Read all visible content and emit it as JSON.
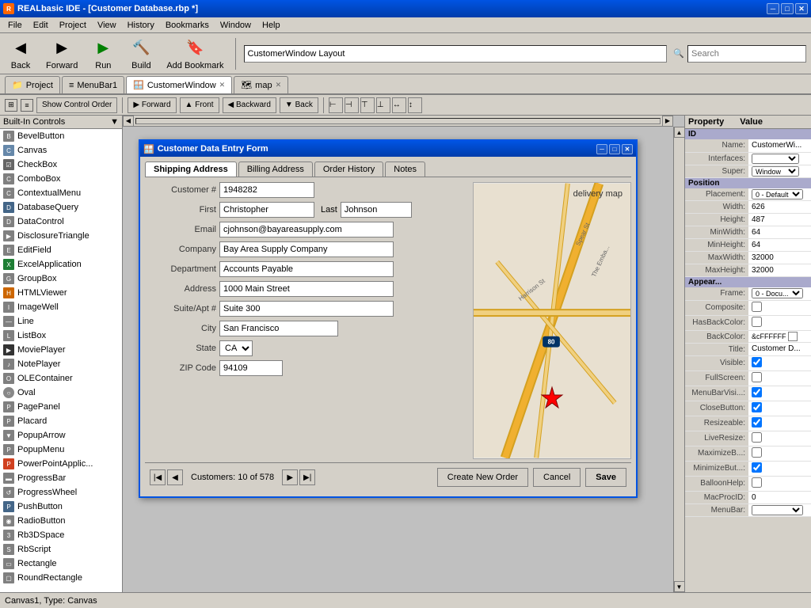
{
  "titlebar": {
    "title": "REALbasic IDE - [Customer Database.rbp *]",
    "icon": "R",
    "min_btn": "─",
    "max_btn": "□",
    "close_btn": "✕"
  },
  "menubar": {
    "items": [
      "File",
      "Edit",
      "Project",
      "View",
      "History",
      "Bookmarks",
      "Window",
      "Help"
    ]
  },
  "toolbar": {
    "back_label": "Back",
    "forward_label": "Forward",
    "run_label": "Run",
    "build_label": "Build",
    "bookmark_label": "Add Bookmark",
    "location_value": "CustomerWindow Layout",
    "search_placeholder": "Search",
    "search_icon": "🔍"
  },
  "tabs": [
    {
      "label": "Project",
      "icon": "📁",
      "active": false,
      "closable": false
    },
    {
      "label": "MenuBar1",
      "icon": "≡",
      "active": false,
      "closable": false
    },
    {
      "label": "CustomerWindow",
      "icon": "🪟",
      "active": true,
      "closable": true
    },
    {
      "label": "map",
      "icon": "🗺",
      "active": false,
      "closable": true
    }
  ],
  "secondary_toolbar": {
    "show_control_order": "Show Control Order",
    "forward_btn": "▶ Forward",
    "front_btn": "▲ Front",
    "backward_btn": "◀ Backward",
    "back_btn": "▼ Back"
  },
  "sidebar": {
    "title": "Built-In Controls",
    "items": [
      "BevelButton",
      "Canvas",
      "CheckBox",
      "ComboBox",
      "ContextualMenu",
      "DatabaseQuery",
      "DataControl",
      "DisclosureTriangle",
      "EditField",
      "ExcelApplication",
      "GroupBox",
      "HTMLViewer",
      "ImageWell",
      "Line",
      "ListBox",
      "MoviePlayer",
      "NotePlayer",
      "OLEContainer",
      "Oval",
      "PagePanel",
      "Placard",
      "PopupArrow",
      "PopupMenu",
      "PowerPointApplic...",
      "ProgressBar",
      "ProgressWheel",
      "PushButton",
      "RadioButton",
      "Rb3DSpace",
      "RbScript",
      "Rectangle",
      "RoundRectangle"
    ]
  },
  "properties": {
    "header": {
      "property": "Property",
      "value": "Value"
    },
    "id_section": "ID",
    "rows": [
      {
        "label": "Name:",
        "value": "CustomerWi..."
      },
      {
        "label": "Interfaces:",
        "value": ""
      },
      {
        "label": "Super:",
        "value": "Window"
      }
    ],
    "position_section": "Position",
    "position_rows": [
      {
        "label": "Placement:",
        "value": "0 - Default"
      },
      {
        "label": "Width:",
        "value": "626"
      },
      {
        "label": "Height:",
        "value": "487"
      },
      {
        "label": "MinWidth:",
        "value": "64"
      },
      {
        "label": "MinHeight:",
        "value": "64"
      },
      {
        "label": "MaxWidth:",
        "value": "32000"
      },
      {
        "label": "MaxHeight:",
        "value": "32000"
      }
    ],
    "appearance_section": "Appear...",
    "appearance_rows": [
      {
        "label": "Frame:",
        "value": "0 - Docu..."
      },
      {
        "label": "Composite:",
        "value": ""
      },
      {
        "label": "HasBackColor:",
        "value": ""
      },
      {
        "label": "BackColor:",
        "value": "&cFFFFFF"
      },
      {
        "label": "Title:",
        "value": "Customer D..."
      },
      {
        "label": "Visible:",
        "value": "checked"
      },
      {
        "label": "FullScreen:",
        "value": ""
      },
      {
        "label": "MenuBarVisi...:",
        "value": "checked"
      },
      {
        "label": "CloseButton:",
        "value": "checked"
      },
      {
        "label": "Resizeable:",
        "value": "checked"
      },
      {
        "label": "LiveResize:",
        "value": ""
      },
      {
        "label": "MaximizeB...:",
        "value": ""
      },
      {
        "label": "MinimizeBut...:",
        "value": "checked"
      },
      {
        "label": "BalloonHelp:",
        "value": ""
      },
      {
        "label": "MacProcID:",
        "value": "0"
      },
      {
        "label": "MenuBar:",
        "value": ""
      }
    ]
  },
  "modal": {
    "title": "Customer Data Entry Form",
    "tabs": [
      "Shipping Address",
      "Billing Address",
      "Order History",
      "Notes"
    ],
    "active_tab": "Shipping Address",
    "fields": {
      "customer_num_label": "Customer #",
      "customer_num_value": "1948282",
      "first_label": "First",
      "first_value": "Christopher",
      "last_label": "Last",
      "last_value": "Johnson",
      "email_label": "Email",
      "email_value": "cjohnson@bayareasupply.com",
      "company_label": "Company",
      "company_value": "Bay Area Supply Company",
      "department_label": "Department",
      "department_value": "Accounts Payable",
      "address_label": "Address",
      "address_value": "1000 Main Street",
      "suite_label": "Suite/Apt #",
      "suite_value": "Suite 300",
      "city_label": "City",
      "city_value": "San Francisco",
      "state_label": "State",
      "state_value": "CA",
      "zip_label": "ZIP Code",
      "zip_value": "94109"
    },
    "map_label": "delivery map",
    "nav": {
      "first_btn": "|◀",
      "prev_btn": "◀",
      "info": "Customers: 10 of 578",
      "next_btn": "▶",
      "last_btn": "▶|",
      "create_btn": "Create New Order",
      "cancel_btn": "Cancel",
      "save_btn": "Save"
    }
  },
  "statusbar": {
    "text": "Canvas1, Type: Canvas"
  }
}
